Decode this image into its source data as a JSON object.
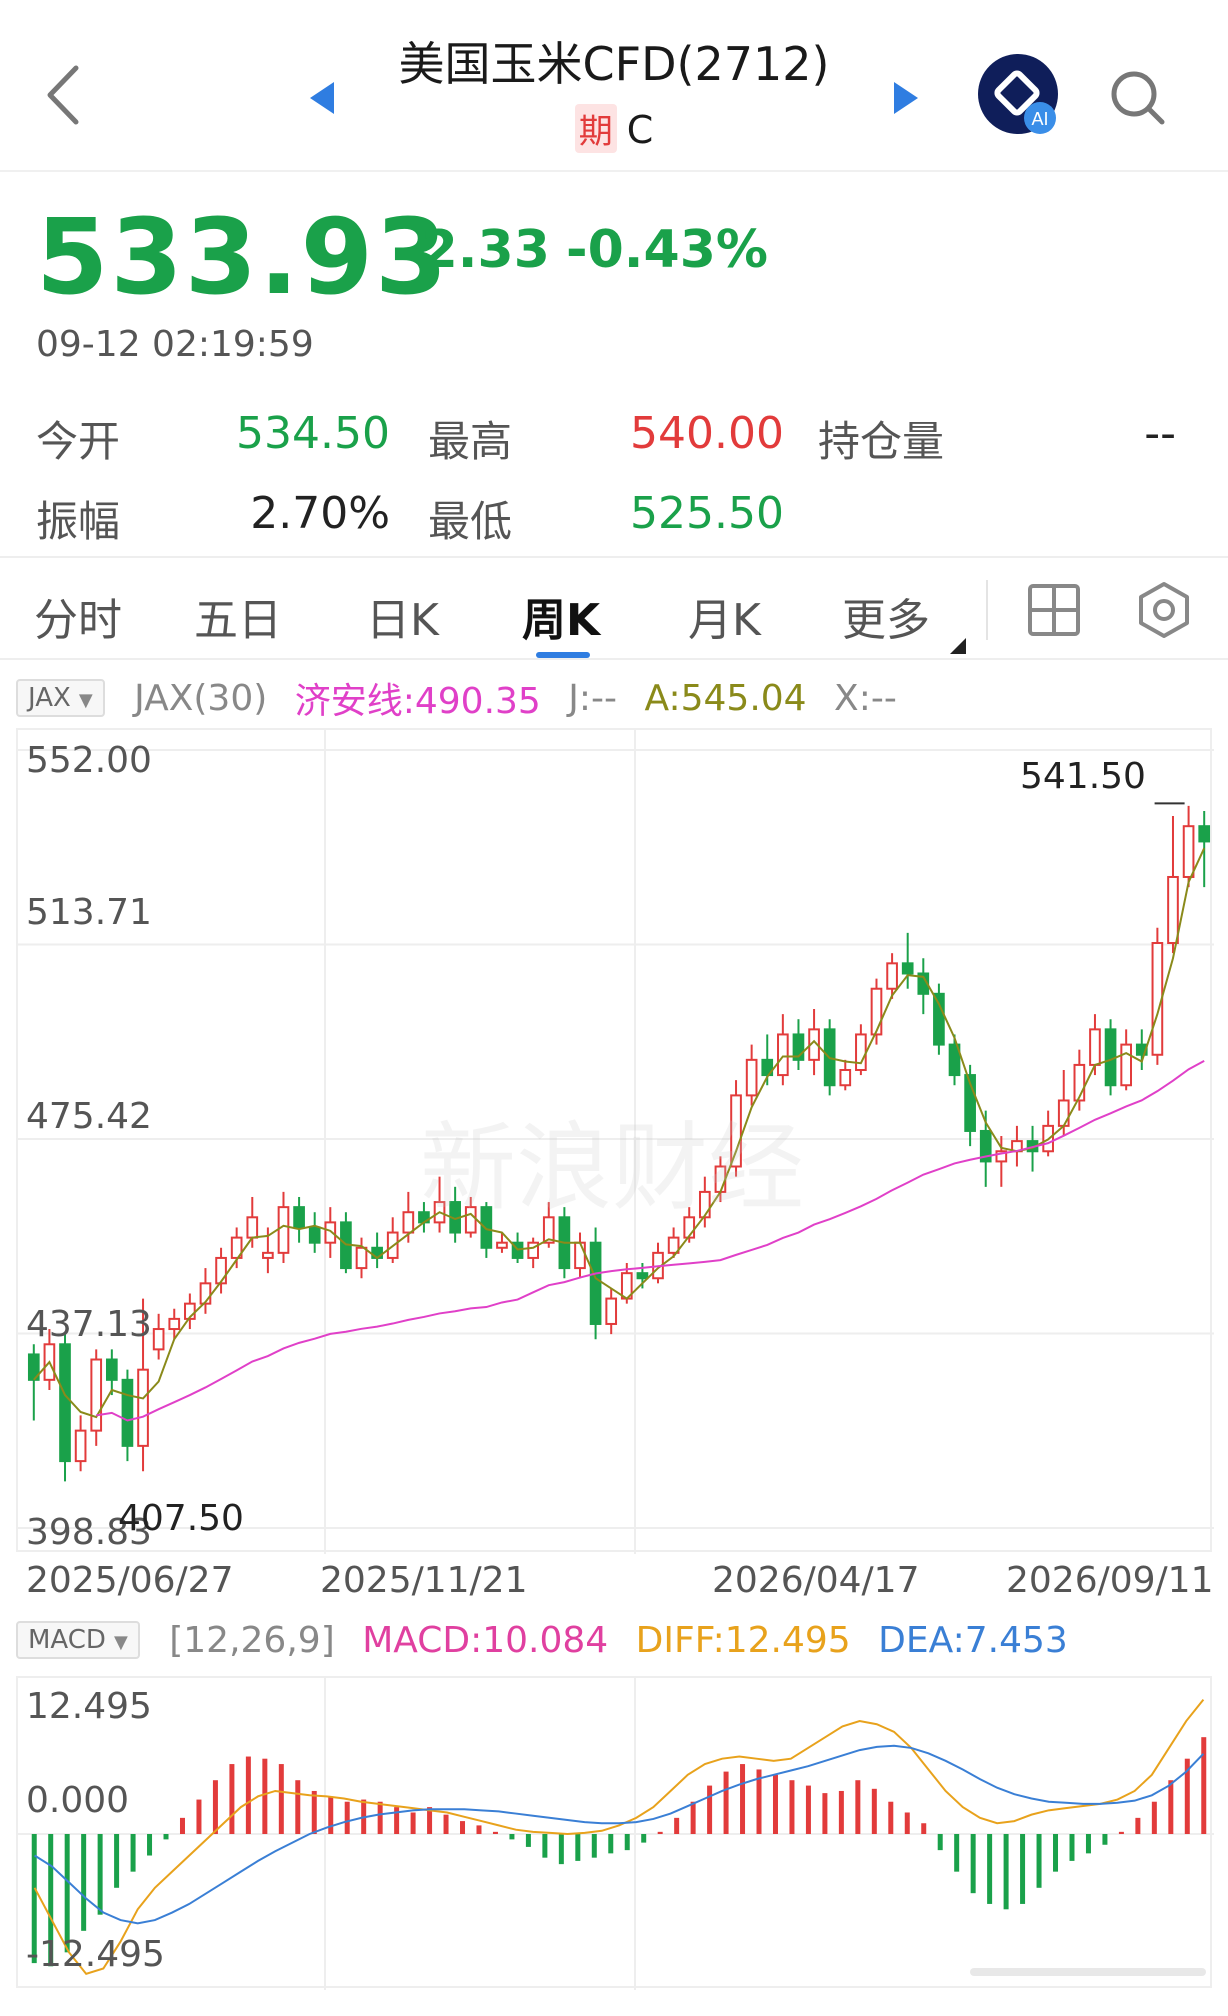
{
  "header": {
    "title": "美国玉米CFD(2712)",
    "badge": "期",
    "code": "C"
  },
  "quote": {
    "price": "533.93",
    "change": "-2.33",
    "change_pct": "-0.43%",
    "timestamp": "09-12 02:19:59"
  },
  "stats": {
    "open_label": "今开",
    "open_value": "534.50",
    "high_label": "最高",
    "high_value": "540.00",
    "oi_label": "持仓量",
    "oi_value": "--",
    "amp_label": "振幅",
    "amp_value": "2.70%",
    "low_label": "最低",
    "low_value": "525.50"
  },
  "tabs": [
    "分时",
    "五日",
    "日K",
    "周K",
    "月K",
    "更多"
  ],
  "active_tab": "周K",
  "indicator_main": {
    "select": "JAX",
    "params": "JAX(30)",
    "line": "济安线:490.35",
    "j": "J:--",
    "a": "A:545.04",
    "x": "X:--"
  },
  "indicator_sub": {
    "select": "MACD",
    "params": "[12,26,9]",
    "macd": "MACD:10.084",
    "diff": "DIFF:12.495",
    "dea": "DEA:7.453"
  },
  "watermark": "新浪财经",
  "colors": {
    "up": "#e23b3b",
    "down": "#1aa14a",
    "jax_line": "#e040c8",
    "a_line": "#8a8a1a",
    "diff_line": "#e8a21c",
    "dea_line": "#3a7fd5",
    "accent": "#2f7de1"
  },
  "chart_data": [
    {
      "type": "candlestick",
      "title": "",
      "y_ticks": [
        "552.00",
        "513.71",
        "475.42",
        "437.13",
        "398.83"
      ],
      "ylim": [
        398.83,
        552.0
      ],
      "x_ticks": [
        "2025/06/27",
        "2025/11/21",
        "2026/04/17",
        "2026/09/11"
      ],
      "max_label": "541.50",
      "min_label": "407.50",
      "candles": [
        [
          433,
          428,
          435,
          420
        ],
        [
          428,
          435,
          438,
          426
        ],
        [
          435,
          412,
          437,
          408
        ],
        [
          412,
          418,
          421,
          410
        ],
        [
          418,
          432,
          434,
          415
        ],
        [
          432,
          428,
          434,
          425
        ],
        [
          428,
          415,
          430,
          412
        ],
        [
          415,
          430,
          444,
          410
        ],
        [
          434,
          438,
          441,
          432
        ],
        [
          438,
          440,
          442,
          436
        ],
        [
          440,
          443,
          445,
          438
        ],
        [
          443,
          447,
          450,
          441
        ],
        [
          447,
          452,
          454,
          445
        ],
        [
          452,
          456,
          458,
          450
        ],
        [
          456,
          460,
          464,
          454
        ],
        [
          452,
          453,
          458,
          449
        ],
        [
          453,
          462,
          465,
          451
        ],
        [
          462,
          458,
          464,
          455
        ],
        [
          458,
          455,
          461,
          453
        ],
        [
          455,
          459,
          462,
          452
        ],
        [
          459,
          450,
          461,
          449
        ],
        [
          450,
          454,
          456,
          448
        ],
        [
          454,
          452,
          457,
          450
        ],
        [
          452,
          457,
          460,
          451
        ],
        [
          457,
          461,
          465,
          455
        ],
        [
          461,
          459,
          463,
          457
        ],
        [
          459,
          463,
          468,
          457
        ],
        [
          463,
          457,
          466,
          455
        ],
        [
          457,
          462,
          464,
          456
        ],
        [
          462,
          454,
          463,
          452
        ],
        [
          454,
          455,
          457,
          453
        ],
        [
          455,
          452,
          457,
          451
        ],
        [
          452,
          455,
          456,
          450
        ],
        [
          455,
          460,
          463,
          454
        ],
        [
          460,
          450,
          462,
          448
        ],
        [
          450,
          455,
          457,
          448
        ],
        [
          455,
          439,
          458,
          436
        ],
        [
          439,
          444,
          446,
          437
        ],
        [
          444,
          449,
          451,
          443
        ],
        [
          449,
          448,
          451,
          446
        ],
        [
          448,
          453,
          455,
          447
        ],
        [
          453,
          456,
          458,
          452
        ],
        [
          456,
          460,
          462,
          455
        ],
        [
          460,
          465,
          468,
          458
        ],
        [
          465,
          470,
          472,
          463
        ],
        [
          470,
          484,
          487,
          468
        ],
        [
          484,
          491,
          494,
          482
        ],
        [
          491,
          488,
          496,
          486
        ],
        [
          488,
          496,
          500,
          486
        ],
        [
          496,
          491,
          499,
          489
        ],
        [
          491,
          497,
          501,
          488
        ],
        [
          497,
          486,
          499,
          484
        ],
        [
          486,
          489,
          491,
          485
        ],
        [
          489,
          496,
          498,
          488
        ],
        [
          496,
          505,
          507,
          494
        ],
        [
          505,
          510,
          512,
          503
        ],
        [
          510,
          508,
          516,
          505
        ],
        [
          508,
          504,
          511,
          500
        ],
        [
          504,
          494,
          506,
          492
        ],
        [
          494,
          488,
          496,
          486
        ],
        [
          488,
          477,
          490,
          474
        ],
        [
          477,
          471,
          481,
          466
        ],
        [
          471,
          473,
          476,
          466
        ],
        [
          473,
          475,
          478,
          470
        ],
        [
          475,
          473,
          478,
          469
        ],
        [
          473,
          478,
          481,
          472
        ],
        [
          478,
          483,
          489,
          476
        ],
        [
          483,
          490,
          493,
          481
        ],
        [
          490,
          497,
          500,
          488
        ],
        [
          497,
          486,
          499,
          484
        ],
        [
          486,
          494,
          497,
          485
        ],
        [
          494,
          492,
          497,
          489
        ],
        [
          492,
          514,
          517,
          490
        ],
        [
          514,
          527,
          539,
          512
        ],
        [
          527,
          537,
          541,
          525
        ],
        [
          537,
          534,
          540,
          525
        ]
      ]
    },
    {
      "type": "bar",
      "title": "MACD",
      "y_ticks": [
        "12.495",
        "0.000",
        "-12.495"
      ],
      "ylim": [
        -14.5,
        14.5
      ],
      "values": [
        -12,
        -12.3,
        -11,
        -9,
        -7.5,
        -5,
        -3.5,
        -2,
        -0.5,
        1.5,
        3.2,
        5,
        6.5,
        7.2,
        7.0,
        6.5,
        5.0,
        4.0,
        3.5,
        3.0,
        3.2,
        3.0,
        2.5,
        2.0,
        2.5,
        1.8,
        1.2,
        0.8,
        0.2,
        -0.5,
        -1.2,
        -2.2,
        -2.8,
        -2.5,
        -2.2,
        -1.8,
        -1.5,
        -0.8,
        0.2,
        1.5,
        3.0,
        4.5,
        5.8,
        6.5,
        6.0,
        5.5,
        5.0,
        4.5,
        3.8,
        4.0,
        5.0,
        4.2,
        3.0,
        2.0,
        1.0,
        -1.5,
        -3.5,
        -5.5,
        -6.5,
        -7.0,
        -6.5,
        -5.0,
        -3.5,
        -2.5,
        -1.8,
        -1.0,
        0.2,
        1.5,
        3.0,
        5.0,
        7.0,
        9.0
      ],
      "diff": [
        -5,
        -8,
        -11,
        -13,
        -12.5,
        -10,
        -7,
        -5,
        -3.5,
        -2,
        -0.5,
        1.0,
        2.5,
        3.5,
        4.0,
        3.8,
        3.6,
        3.5,
        3.3,
        3.0,
        2.8,
        2.6,
        2.4,
        2.2,
        2.0,
        1.6,
        1.2,
        0.8,
        0.4,
        0.2,
        0.1,
        0.0,
        0.1,
        0.3,
        0.8,
        1.5,
        2.5,
        4.0,
        5.5,
        6.5,
        7.0,
        7.2,
        7.0,
        6.8,
        7.0,
        8.0,
        9.0,
        10.0,
        10.5,
        10.2,
        9.5,
        8.0,
        6.0,
        4.0,
        2.5,
        1.5,
        1.0,
        1.2,
        1.8,
        2.2,
        2.4,
        2.6,
        2.8,
        3.2,
        4.0,
        5.5,
        8.0,
        10.5,
        12.495
      ],
      "dea": [
        -2,
        -3,
        -4.5,
        -6,
        -7.3,
        -8,
        -8.3,
        -8.0,
        -7.3,
        -6.5,
        -5.5,
        -4.5,
        -3.5,
        -2.5,
        -1.6,
        -0.8,
        0.0,
        0.6,
        1.1,
        1.5,
        1.8,
        2.0,
        2.2,
        2.3,
        2.3,
        2.3,
        2.2,
        2.1,
        1.9,
        1.7,
        1.5,
        1.3,
        1.1,
        1.0,
        1.0,
        1.1,
        1.4,
        1.9,
        2.6,
        3.3,
        4.0,
        4.6,
        5.1,
        5.5,
        5.9,
        6.3,
        6.8,
        7.3,
        7.8,
        8.1,
        8.2,
        8.0,
        7.5,
        6.8,
        6.0,
        5.1,
        4.3,
        3.7,
        3.3,
        3.0,
        2.9,
        2.8,
        2.8,
        2.9,
        3.1,
        3.6,
        4.5,
        5.8,
        7.453
      ]
    }
  ]
}
